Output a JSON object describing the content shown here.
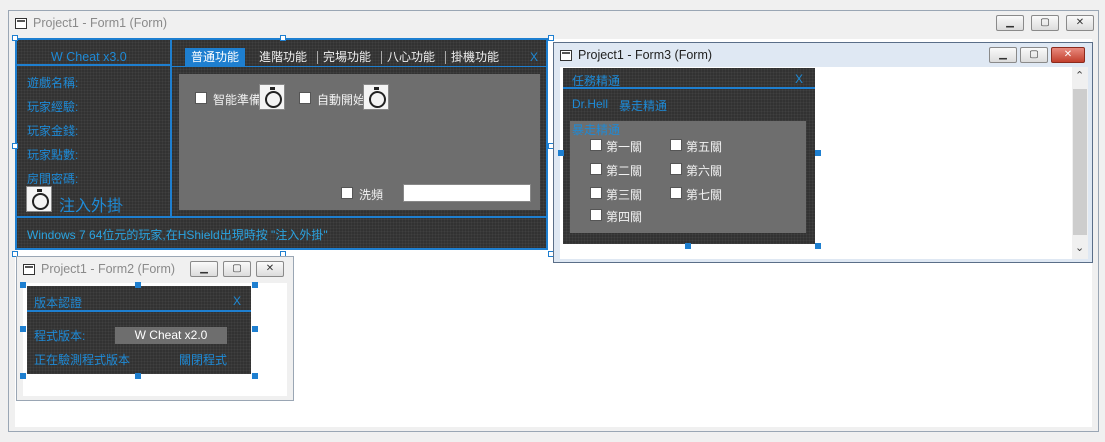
{
  "form1": {
    "title": "Project1 - Form1 (Form)",
    "app_header": "W Cheat x3.0",
    "tabs": [
      "普通功能",
      "進階功能",
      "完場功能",
      "八心功能",
      "掛機功能"
    ],
    "tab_close": "X",
    "info_labels": [
      "遊戲名稱:",
      "玩家經驗:",
      "玩家金錢:",
      "玩家點數:",
      "房間密碼:"
    ],
    "inject_label": "注入外掛",
    "options": {
      "smart_prepare": "智能準備",
      "auto_start": "自動開始",
      "wash": "洗頻"
    },
    "wash_input": "",
    "footer": "Windows 7 64位元的玩家,在HShield出現時按 \"注入外掛\""
  },
  "form2": {
    "title": "Project1 - Form2 (Form)",
    "header": "版本認證",
    "close": "X",
    "version_label": "程式版本:",
    "version_value": "W Cheat x2.0",
    "status": "正在驗測程式版本",
    "close_program": "關閉程式"
  },
  "form3": {
    "title": "Project1 - Form3 (Form)",
    "header": "任務精通",
    "close": "X",
    "user": "Dr.Hell",
    "mode": "暴走精通",
    "group_label": "暴走精通",
    "levels_left": [
      "第一關",
      "第二關",
      "第三關",
      "第四關"
    ],
    "levels_right": [
      "第五關",
      "第六關",
      "第七關"
    ]
  },
  "colors": {
    "accent": "#1e7fd0",
    "dark_panel": "#323232",
    "inner_panel": "#6e6e6e"
  }
}
